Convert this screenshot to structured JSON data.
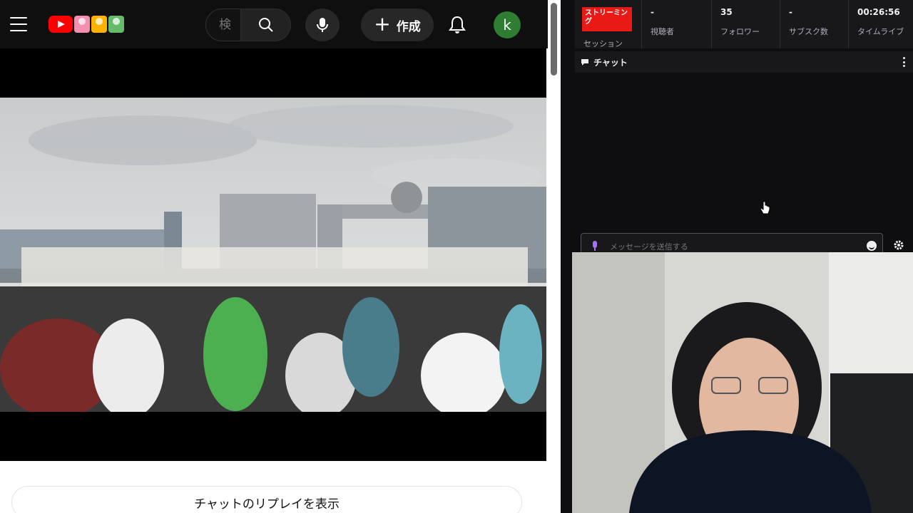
{
  "youtube": {
    "search": {
      "placeholder": "検",
      "value": ""
    },
    "create_label": "作成",
    "avatar_letter": "k",
    "replay_chat_label": "チャットのリプレイを表示"
  },
  "dashboard": {
    "stream_badge": "ストリーミング",
    "session_label": "セッション",
    "stats": [
      {
        "value": "-",
        "label": "視聴者"
      },
      {
        "value": "35",
        "label": "フォロワー"
      },
      {
        "value": "-",
        "label": "サブスク数"
      },
      {
        "value": "00:26:56",
        "label": "タイムライブ"
      }
    ],
    "chat_title": "チャット",
    "message_placeholder": "メッセージを送信する"
  },
  "colors": {
    "youtube_red": "#ff0000",
    "live_badge": "#e91916",
    "avatar_bg": "#2e7d32",
    "dash_bg": "#0e0e10",
    "mic_accent": "#a970ff"
  },
  "icons": [
    "menu-icon",
    "youtube-logo",
    "search-icon",
    "mic-icon",
    "plus-icon",
    "bell-icon",
    "chat-bubble-icon",
    "more-vertical-icon",
    "emoji-icon",
    "gear-icon",
    "pointer-cursor-icon"
  ]
}
